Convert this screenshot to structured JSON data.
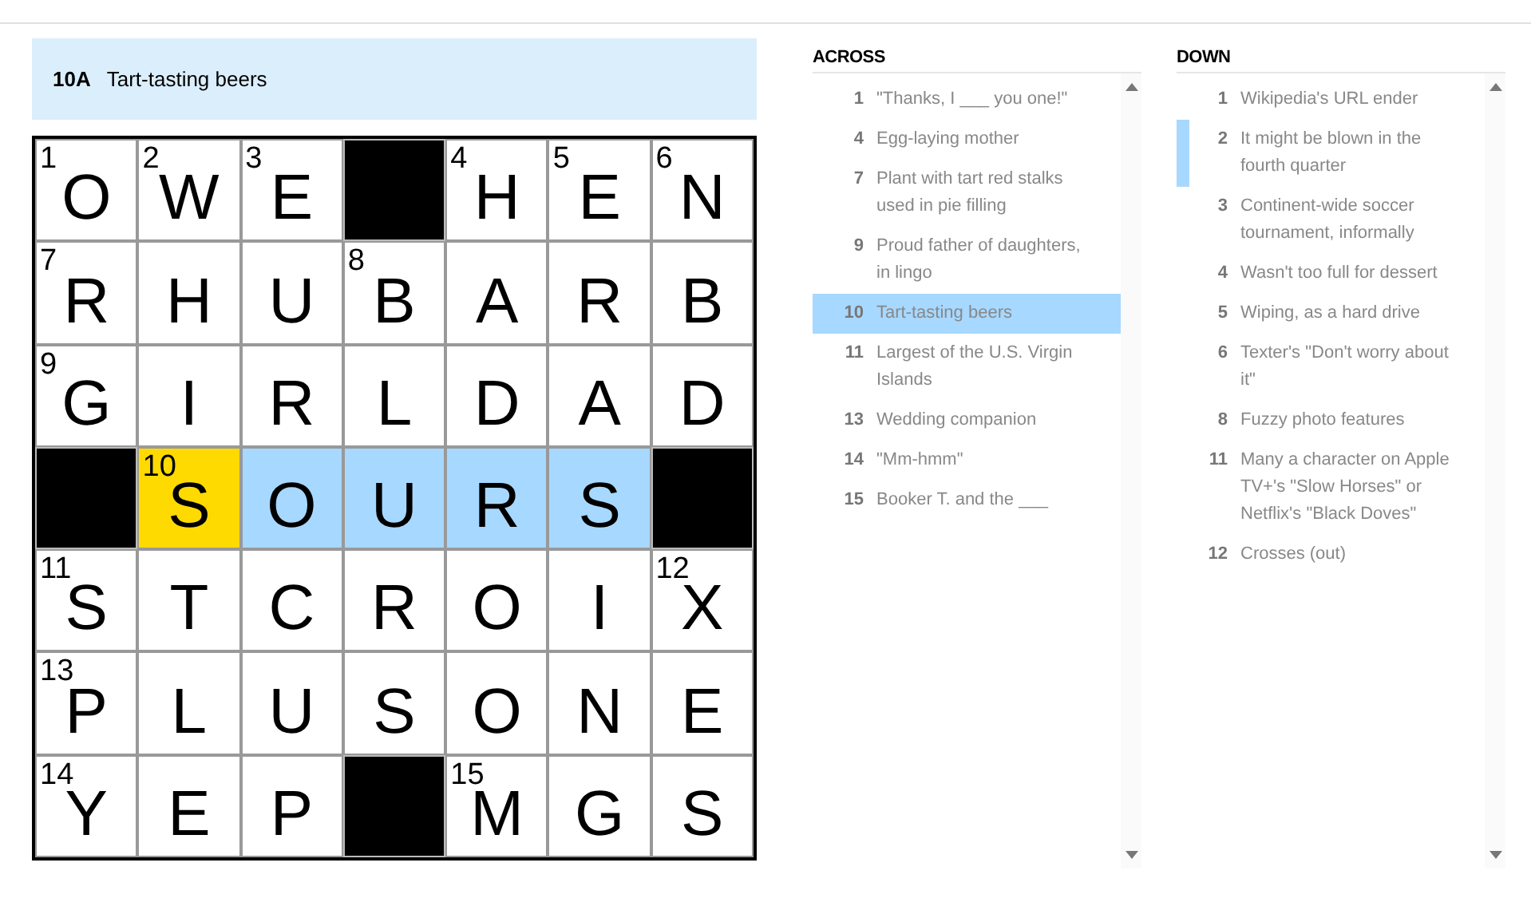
{
  "clue_bar": {
    "label": "10A",
    "text": "Tart-tasting beers"
  },
  "grid": [
    [
      {
        "kind": "letter",
        "number": "1",
        "letter": "O",
        "selected": false,
        "highlighted": false
      },
      {
        "kind": "letter",
        "number": "2",
        "letter": "W",
        "selected": false,
        "highlighted": false
      },
      {
        "kind": "letter",
        "number": "3",
        "letter": "E",
        "selected": false,
        "highlighted": false
      },
      {
        "kind": "block"
      },
      {
        "kind": "letter",
        "number": "4",
        "letter": "H",
        "selected": false,
        "highlighted": false
      },
      {
        "kind": "letter",
        "number": "5",
        "letter": "E",
        "selected": false,
        "highlighted": false
      },
      {
        "kind": "letter",
        "number": "6",
        "letter": "N",
        "selected": false,
        "highlighted": false
      }
    ],
    [
      {
        "kind": "letter",
        "number": "7",
        "letter": "R",
        "selected": false,
        "highlighted": false
      },
      {
        "kind": "letter",
        "letter": "H",
        "selected": false,
        "highlighted": false
      },
      {
        "kind": "letter",
        "letter": "U",
        "selected": false,
        "highlighted": false
      },
      {
        "kind": "letter",
        "number": "8",
        "letter": "B",
        "selected": false,
        "highlighted": false
      },
      {
        "kind": "letter",
        "letter": "A",
        "selected": false,
        "highlighted": false
      },
      {
        "kind": "letter",
        "letter": "R",
        "selected": false,
        "highlighted": false
      },
      {
        "kind": "letter",
        "letter": "B",
        "selected": false,
        "highlighted": false
      }
    ],
    [
      {
        "kind": "letter",
        "number": "9",
        "letter": "G",
        "selected": false,
        "highlighted": false
      },
      {
        "kind": "letter",
        "letter": "I",
        "selected": false,
        "highlighted": false
      },
      {
        "kind": "letter",
        "letter": "R",
        "selected": false,
        "highlighted": false
      },
      {
        "kind": "letter",
        "letter": "L",
        "selected": false,
        "highlighted": false
      },
      {
        "kind": "letter",
        "letter": "D",
        "selected": false,
        "highlighted": false
      },
      {
        "kind": "letter",
        "letter": "A",
        "selected": false,
        "highlighted": false
      },
      {
        "kind": "letter",
        "letter": "D",
        "selected": false,
        "highlighted": false
      }
    ],
    [
      {
        "kind": "block"
      },
      {
        "kind": "letter",
        "number": "10",
        "letter": "S",
        "selected": true
      },
      {
        "kind": "letter",
        "letter": "O",
        "selected": false,
        "highlighted": true
      },
      {
        "kind": "letter",
        "letter": "U",
        "selected": false,
        "highlighted": true
      },
      {
        "kind": "letter",
        "letter": "R",
        "selected": false,
        "highlighted": true
      },
      {
        "kind": "letter",
        "letter": "S",
        "selected": false,
        "highlighted": true
      },
      {
        "kind": "block"
      }
    ],
    [
      {
        "kind": "letter",
        "number": "11",
        "letter": "S",
        "selected": false,
        "highlighted": false
      },
      {
        "kind": "letter",
        "letter": "T",
        "selected": false,
        "highlighted": false
      },
      {
        "kind": "letter",
        "letter": "C",
        "selected": false,
        "highlighted": false
      },
      {
        "kind": "letter",
        "letter": "R",
        "selected": false,
        "highlighted": false
      },
      {
        "kind": "letter",
        "letter": "O",
        "selected": false,
        "highlighted": false
      },
      {
        "kind": "letter",
        "letter": "I",
        "selected": false,
        "highlighted": false
      },
      {
        "kind": "letter",
        "number": "12",
        "letter": "X",
        "selected": false,
        "highlighted": false
      }
    ],
    [
      {
        "kind": "letter",
        "number": "13",
        "letter": "P",
        "selected": false,
        "highlighted": false
      },
      {
        "kind": "letter",
        "letter": "L",
        "selected": false,
        "highlighted": false
      },
      {
        "kind": "letter",
        "letter": "U",
        "selected": false,
        "highlighted": false
      },
      {
        "kind": "letter",
        "letter": "S",
        "selected": false,
        "highlighted": false
      },
      {
        "kind": "letter",
        "letter": "O",
        "selected": false,
        "highlighted": false
      },
      {
        "kind": "letter",
        "letter": "N",
        "selected": false,
        "highlighted": false
      },
      {
        "kind": "letter",
        "letter": "E",
        "selected": false,
        "highlighted": false
      }
    ],
    [
      {
        "kind": "letter",
        "number": "14",
        "letter": "Y",
        "selected": false,
        "highlighted": false
      },
      {
        "kind": "letter",
        "letter": "E",
        "selected": false,
        "highlighted": false
      },
      {
        "kind": "letter",
        "letter": "P",
        "selected": false,
        "highlighted": false
      },
      {
        "kind": "block"
      },
      {
        "kind": "letter",
        "number": "15",
        "letter": "M",
        "selected": false,
        "highlighted": false
      },
      {
        "kind": "letter",
        "letter": "G",
        "selected": false,
        "highlighted": false
      },
      {
        "kind": "letter",
        "letter": "S",
        "selected": false,
        "highlighted": false
      }
    ]
  ],
  "clue_lists": [
    {
      "title": "ACROSS",
      "clues": [
        {
          "number": "1",
          "text": "\"Thanks, I ___ you one!\"",
          "selected": false,
          "crossing": false
        },
        {
          "number": "4",
          "text": "Egg-laying mother",
          "selected": false,
          "crossing": false
        },
        {
          "number": "7",
          "text": "Plant with tart red stalks used in pie filling",
          "selected": false,
          "crossing": false
        },
        {
          "number": "9",
          "text": "Proud father of daughters, in lingo",
          "selected": false,
          "crossing": false
        },
        {
          "number": "10",
          "text": "Tart-tasting beers",
          "selected": true,
          "crossing": false
        },
        {
          "number": "11",
          "text": "Largest of the U.S. Virgin Islands",
          "selected": false,
          "crossing": false
        },
        {
          "number": "13",
          "text": "Wedding companion",
          "selected": false,
          "crossing": false
        },
        {
          "number": "14",
          "text": "\"Mm-hmm\"",
          "selected": false,
          "crossing": false
        },
        {
          "number": "15",
          "text": "Booker T. and the ___",
          "selected": false,
          "crossing": false
        }
      ]
    },
    {
      "title": "DOWN",
      "clues": [
        {
          "number": "1",
          "text": "Wikipedia's URL ender",
          "selected": false,
          "crossing": false
        },
        {
          "number": "2",
          "text": "It might be blown in the fourth quarter",
          "selected": false,
          "crossing": true
        },
        {
          "number": "3",
          "text": "Continent-wide soccer tournament, informally",
          "selected": false,
          "crossing": false
        },
        {
          "number": "4",
          "text": "Wasn't too full for dessert",
          "selected": false,
          "crossing": false
        },
        {
          "number": "5",
          "text": "Wiping, as a hard drive",
          "selected": false,
          "crossing": false
        },
        {
          "number": "6",
          "text": "Texter's \"Don't worry about it\"",
          "selected": false,
          "crossing": false
        },
        {
          "number": "8",
          "text": "Fuzzy photo features",
          "selected": false,
          "crossing": false
        },
        {
          "number": "11",
          "text": "Many a character on Apple TV+'s \"Slow Horses\" or Netflix's \"Black Doves\"",
          "selected": false,
          "crossing": false
        },
        {
          "number": "12",
          "text": "Crosses (out)",
          "selected": false,
          "crossing": false
        }
      ]
    }
  ]
}
